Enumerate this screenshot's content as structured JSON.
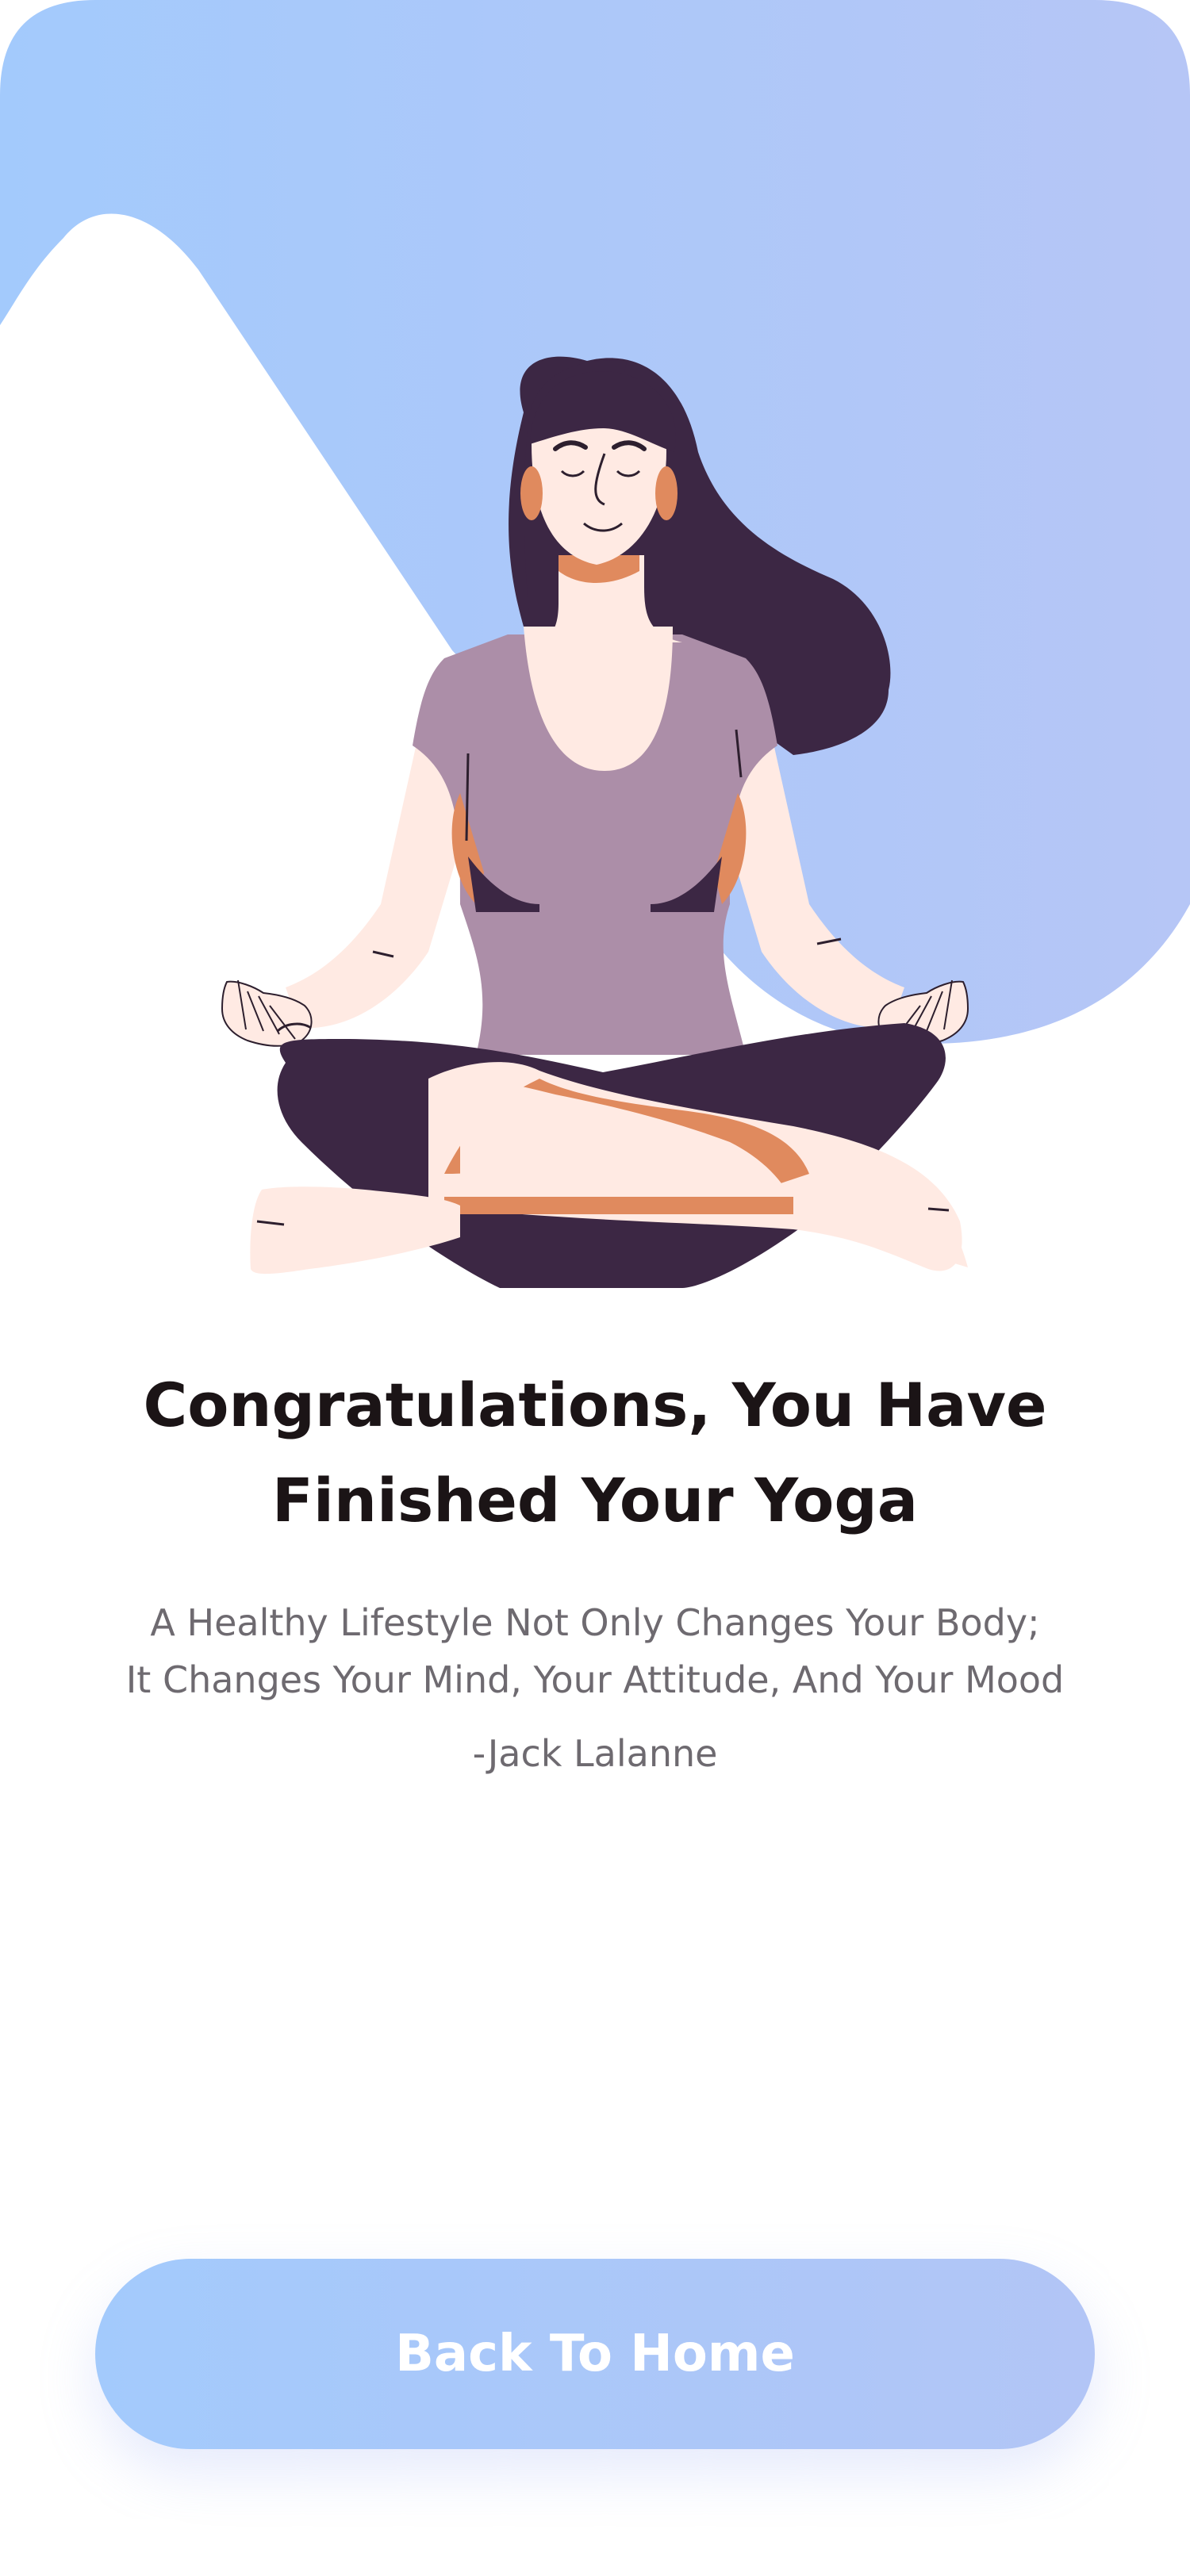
{
  "completion": {
    "headline_line1": "Congratulations, You Have",
    "headline_line2": "Finished Your Yoga",
    "quote_line1": "A Healthy Lifestyle Not Only Changes Your Body;",
    "quote_line2": "It Changes Your Mind, Your Attitude, And Your Mood",
    "author": "-Jack Lalanne",
    "cta_label": "Back To Home"
  },
  "colors": {
    "gradient_start": "#a3cafc",
    "gradient_end": "#b2c5f6",
    "hair": "#3c2744",
    "shirt": "#ac8ea8",
    "skin": "#ffeae3",
    "accent_orange": "#e08a5e",
    "headline_text": "#1b1416",
    "body_text": "#6e6a70"
  },
  "illustration": {
    "subject": "woman-meditating-lotus-pose",
    "background_icon": "wave-blob-icon"
  }
}
